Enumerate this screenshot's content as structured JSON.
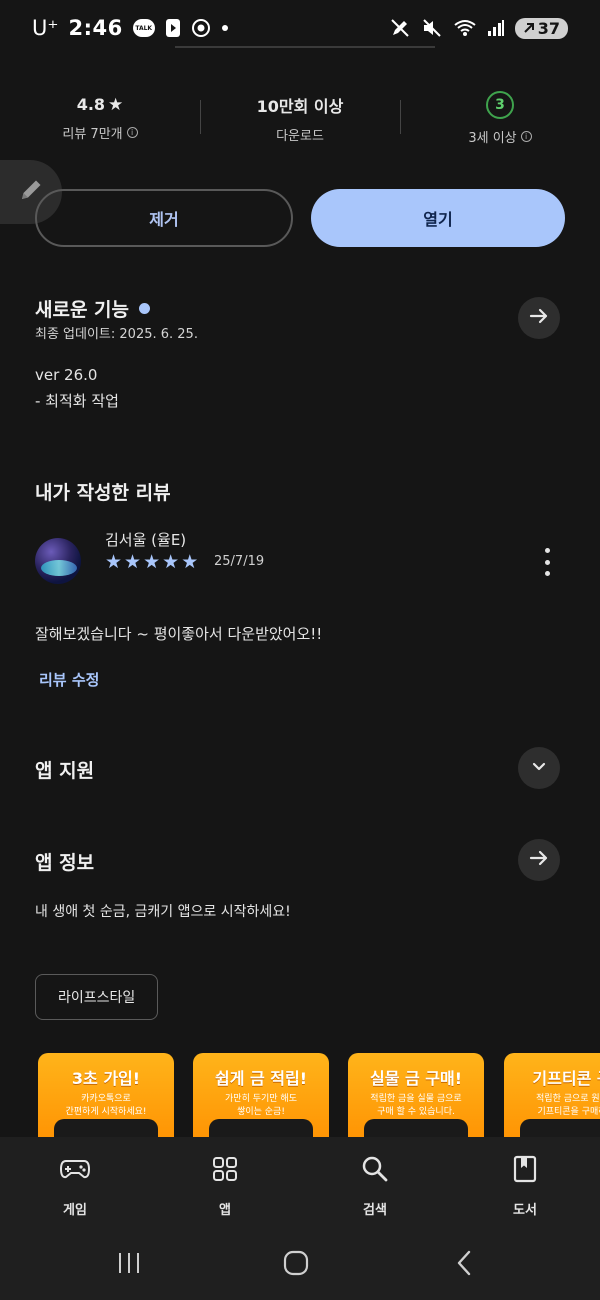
{
  "status_bar": {
    "carrier": "U⁺",
    "time": "2:46",
    "battery": "37",
    "icons": [
      "kakaotalk-icon",
      "media-play-icon",
      "chrome-icon",
      "dot-icon",
      "pen-off-icon",
      "mute-icon",
      "wifi-icon",
      "signal-icon",
      "battery-icon"
    ]
  },
  "stats": {
    "rating": "4.8",
    "rating_label": "리뷰 7만개",
    "downloads": "10만회 이상",
    "downloads_label": "다운로드",
    "age_badge": "3",
    "age_label": "3세 이상"
  },
  "actions": {
    "remove": "제거",
    "open": "열기"
  },
  "whats_new": {
    "title": "새로운 기능",
    "updated": "최종 업데이트: 2025. 6. 25.",
    "version": "ver 26.0",
    "note": "- 최적화 작업"
  },
  "my_review": {
    "title": "내가 작성한 리뷰",
    "author": "김서울 (율E)",
    "stars": [
      "★",
      "★",
      "★",
      "★",
      "★"
    ],
    "rating_value": 5,
    "date": "25/7/19",
    "text": "잘해보겠습니다 ~ 평이좋아서 다운받았어오!!",
    "edit": "리뷰 수정"
  },
  "app_support": {
    "title": "앱 지원"
  },
  "app_info": {
    "title": "앱 정보",
    "description": "내 생애 첫 순금, 금캐기 앱으로 시작하세요!",
    "category": "라이프스타일"
  },
  "screenshots": [
    {
      "title": "3초 가입!",
      "sub": "카카오톡으로\n간편하게 시작하세요!"
    },
    {
      "title": "쉽게 금 적립!",
      "sub": "가만히 두기만 해도\n쌓이는 순금!"
    },
    {
      "title": "실물 금 구매!",
      "sub": "적립한 금을 실물 금으로\n구매 할 수 있습니다."
    },
    {
      "title": "기프티콘 구",
      "sub": "적립한 금으로 원하\n기프티콘을 구매하"
    }
  ],
  "bottom_nav": [
    {
      "label": "게임",
      "icon": "gamepad-icon"
    },
    {
      "label": "앱",
      "icon": "apps-grid-icon"
    },
    {
      "label": "검색",
      "icon": "search-icon"
    },
    {
      "label": "도서",
      "icon": "book-icon"
    }
  ],
  "colors": {
    "background": "#151515",
    "accent": "#a9c6fb",
    "age_badge_green": "#3fa34d",
    "screenshot_orange": "#ff9f0a"
  }
}
